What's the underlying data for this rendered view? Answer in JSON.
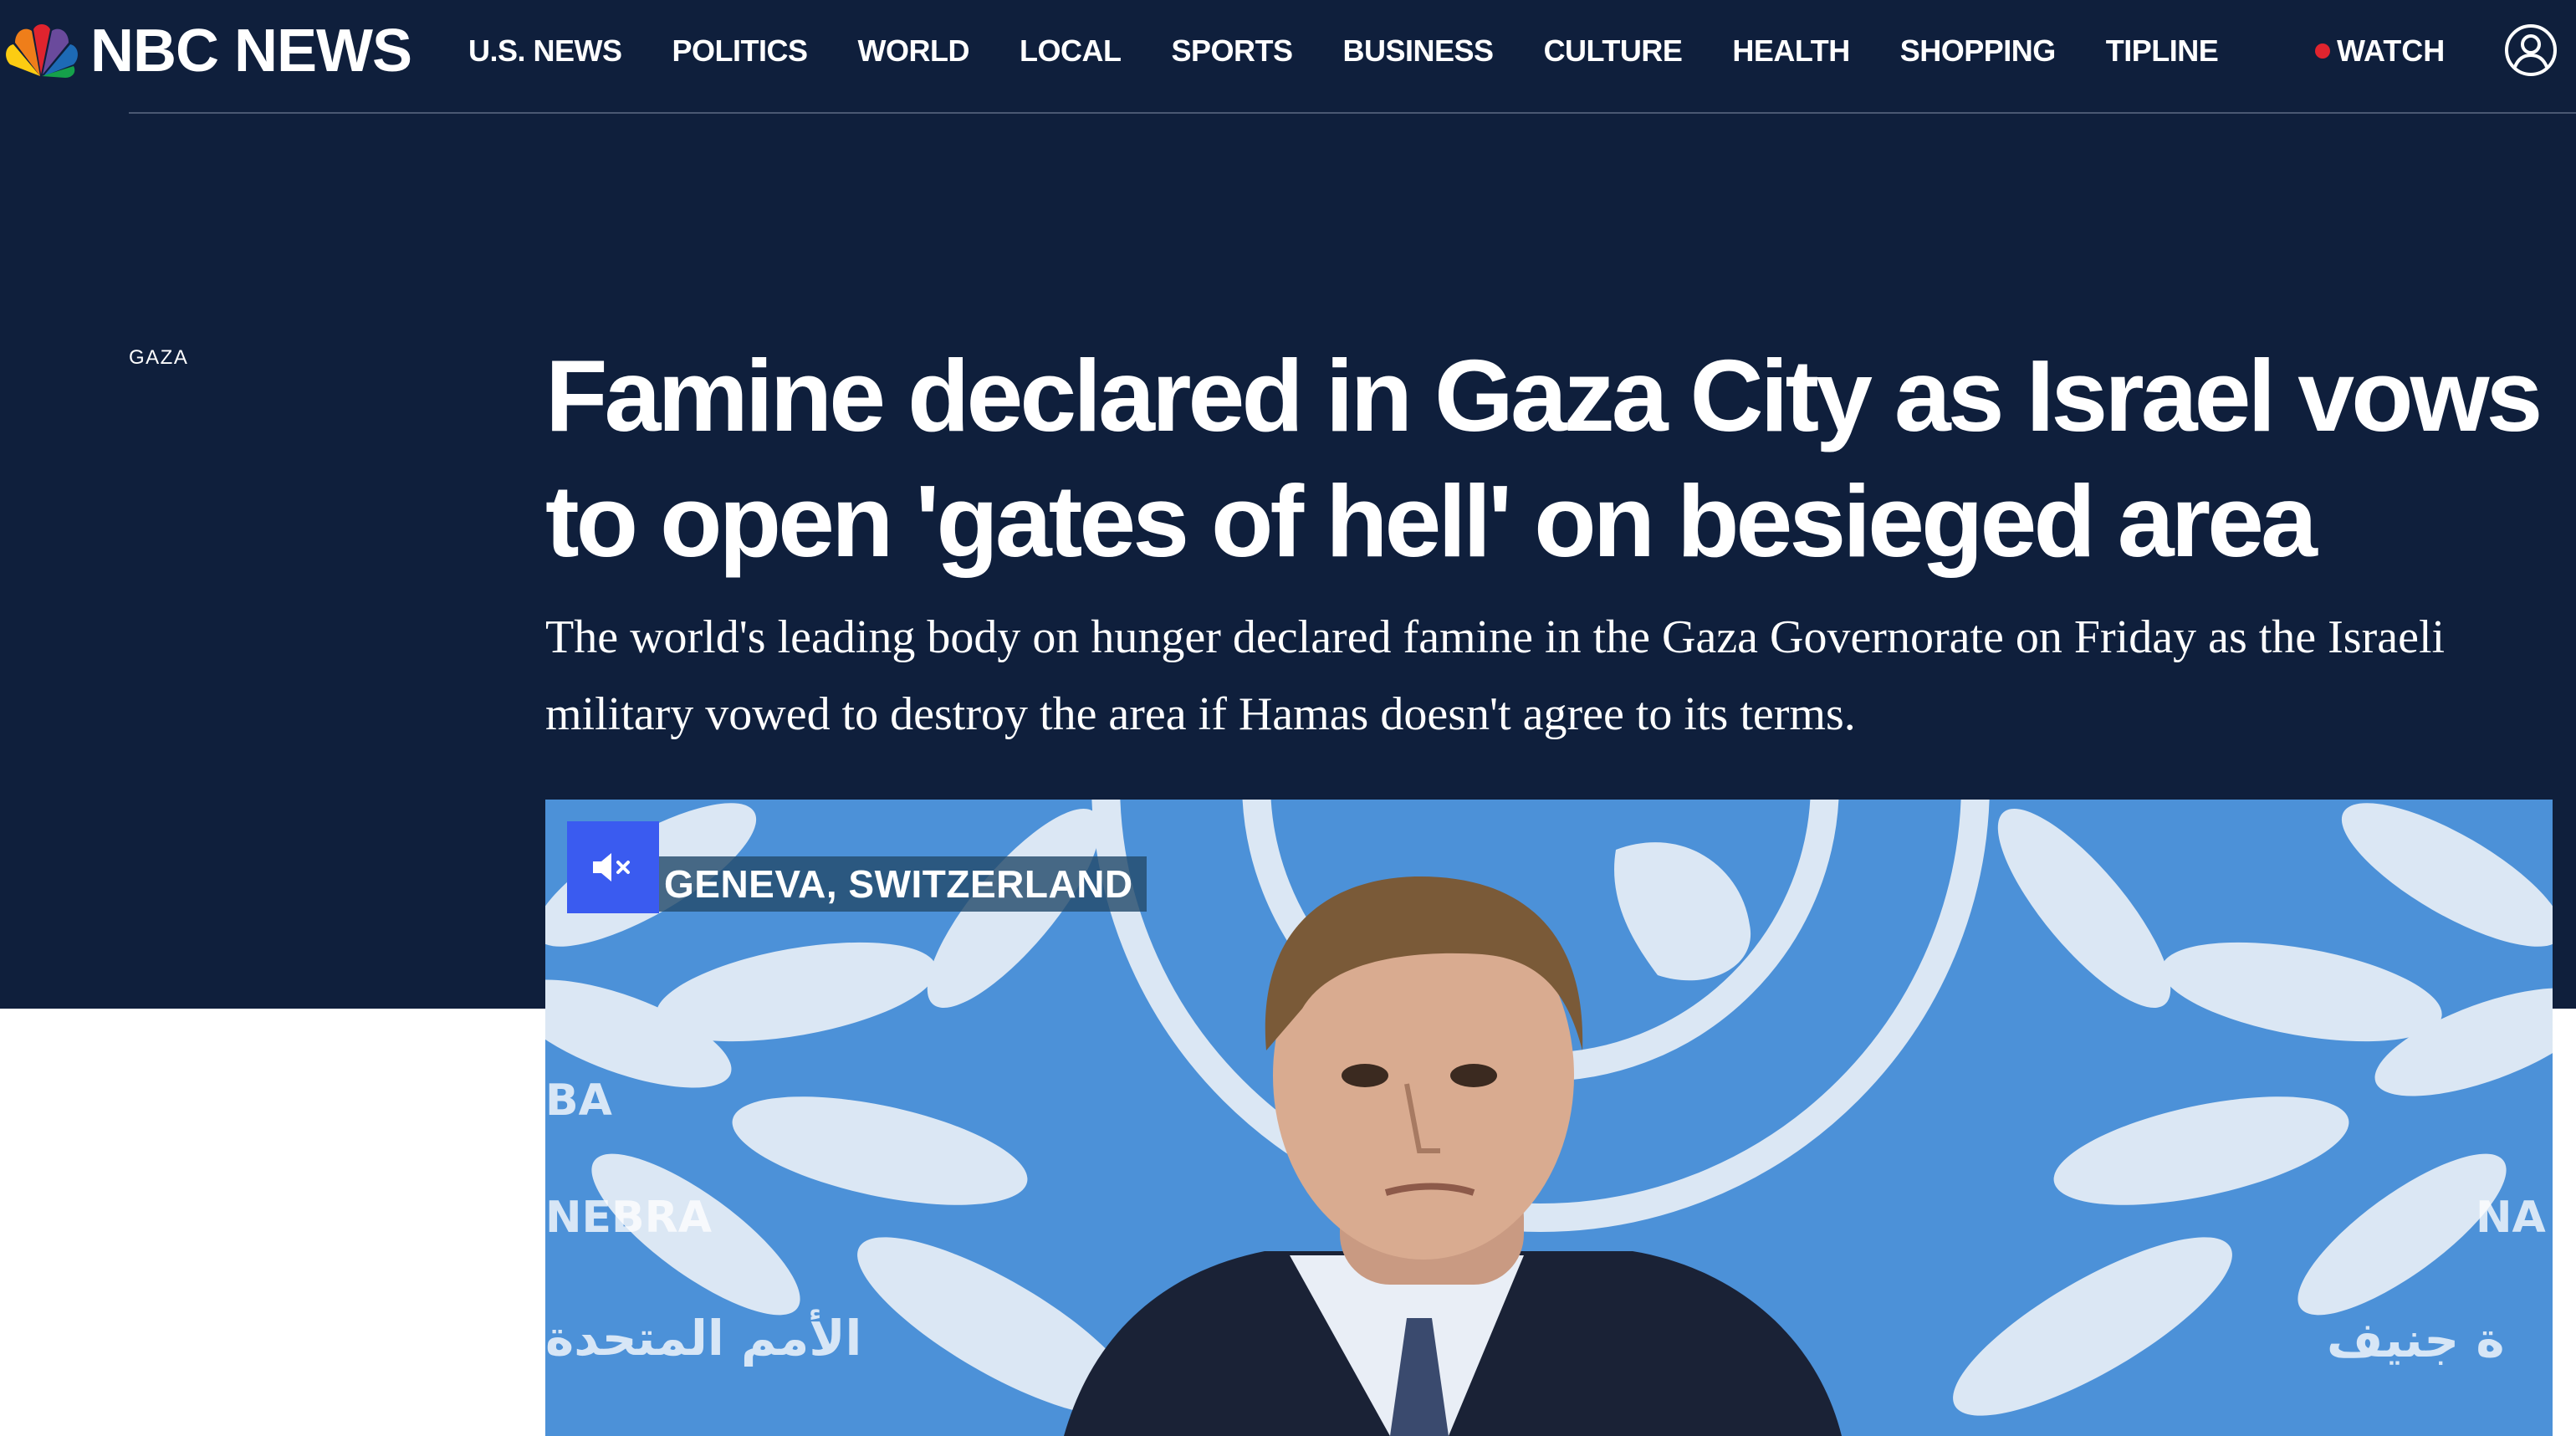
{
  "brand": {
    "name": "NBC NEWS",
    "logo_icon": "nbc-peacock-icon",
    "colors": {
      "background": "#0f1f3c",
      "live_dot": "#e0242e",
      "mute_button": "#3a5bf0"
    }
  },
  "nav": {
    "items": [
      {
        "label": "U.S. NEWS"
      },
      {
        "label": "POLITICS"
      },
      {
        "label": "WORLD"
      },
      {
        "label": "LOCAL"
      },
      {
        "label": "SPORTS"
      },
      {
        "label": "BUSINESS"
      },
      {
        "label": "CULTURE"
      },
      {
        "label": "HEALTH"
      },
      {
        "label": "SHOPPING"
      },
      {
        "label": "TIPLINE"
      }
    ],
    "watch_label": "WATCH",
    "account_icon": "account-icon"
  },
  "article": {
    "section": "GAZA",
    "headline": "Famine declared in Gaza City as Israel vows to open 'gates of hell' on besieged area",
    "dek": "The world's leading body on hunger declared famine in the Gaza Governorate on Friday as the Israeli military vowed to destroy the area if Hamas doesn't agree to its terms."
  },
  "video": {
    "location": "GENEVA, SWITZERLAND",
    "mute_icon": "muted-speaker-icon",
    "placards": {
      "left_1": "BA",
      "left_2": "NEBRA",
      "left_3": "الأمم المتحدة",
      "right_1": "NA",
      "right_2": "ة جنيف"
    }
  }
}
